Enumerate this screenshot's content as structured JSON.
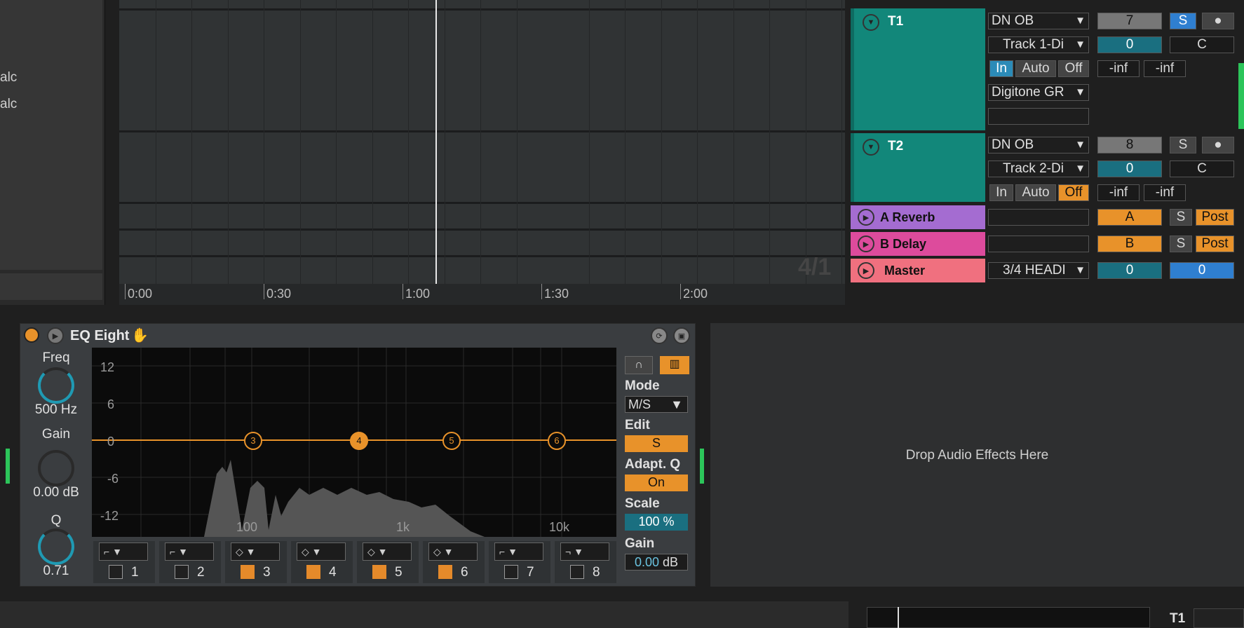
{
  "browser": {
    "items": [
      "alc",
      "alc"
    ]
  },
  "timeline": {
    "labels": [
      "0:00",
      "0:30",
      "1:00",
      "1:30",
      "2:00"
    ],
    "loop_label": "4/1"
  },
  "tracks": [
    {
      "name": "T1",
      "input": "DN OB",
      "channel": "Track 1-Di",
      "monitor": [
        "In",
        "Auto",
        "Off"
      ],
      "output": "Digitone GR",
      "number": "7",
      "solo": "S",
      "volume": "0",
      "pan": "C",
      "peak_l": "-inf",
      "peak_r": "-inf"
    },
    {
      "name": "T2",
      "input": "DN OB",
      "channel": "Track 2-Di",
      "monitor": [
        "In",
        "Auto",
        "Off"
      ],
      "number": "8",
      "solo": "S",
      "volume": "0",
      "pan": "C",
      "peak_l": "-inf",
      "peak_r": "-inf"
    }
  ],
  "returns": [
    {
      "name": "A Reverb",
      "send": "A",
      "solo": "S",
      "post": "Post",
      "color": "#a46cd1"
    },
    {
      "name": "B Delay",
      "send": "B",
      "solo": "S",
      "post": "Post",
      "color": "#dd4b9c"
    }
  ],
  "master": {
    "name": "Master",
    "output": "3/4 HEADI",
    "vol": "0",
    "pan": "0",
    "color": "#f0707f"
  },
  "colors": {
    "track": "#12877a",
    "accent": "#e8922a",
    "blue": "#2f7fd0"
  },
  "eq": {
    "title": "EQ Eight",
    "freq_label": "Freq",
    "freq_value": "500 Hz",
    "gain_label": "Gain",
    "gain_value": "0.00 dB",
    "q_label": "Q",
    "q_value": "0.71",
    "db_labels": [
      "12",
      "6",
      "0",
      "-6",
      "-12"
    ],
    "freq_labels": [
      "100",
      "1k",
      "10k"
    ],
    "nodes": [
      "3",
      "4",
      "5",
      "6"
    ],
    "bands": [
      {
        "num": "1",
        "on": false,
        "shape": "low-cut"
      },
      {
        "num": "2",
        "on": false,
        "shape": "low-shelf"
      },
      {
        "num": "3",
        "on": true,
        "shape": "bell"
      },
      {
        "num": "4",
        "on": true,
        "shape": "bell"
      },
      {
        "num": "5",
        "on": true,
        "shape": "bell"
      },
      {
        "num": "6",
        "on": true,
        "shape": "bell"
      },
      {
        "num": "7",
        "on": false,
        "shape": "high-shelf"
      },
      {
        "num": "8",
        "on": false,
        "shape": "high-cut"
      }
    ],
    "mode_label": "Mode",
    "mode_value": "M/S",
    "edit_label": "Edit",
    "edit_value": "S",
    "adapt_label": "Adapt. Q",
    "adapt_value": "On",
    "scale_label": "Scale",
    "scale_value": "100 %",
    "gainout_label": "Gain",
    "gainout_value": "0.00",
    "gainout_unit": "dB"
  },
  "drop_text": "Drop Audio Effects Here",
  "bottom_track": "T1"
}
